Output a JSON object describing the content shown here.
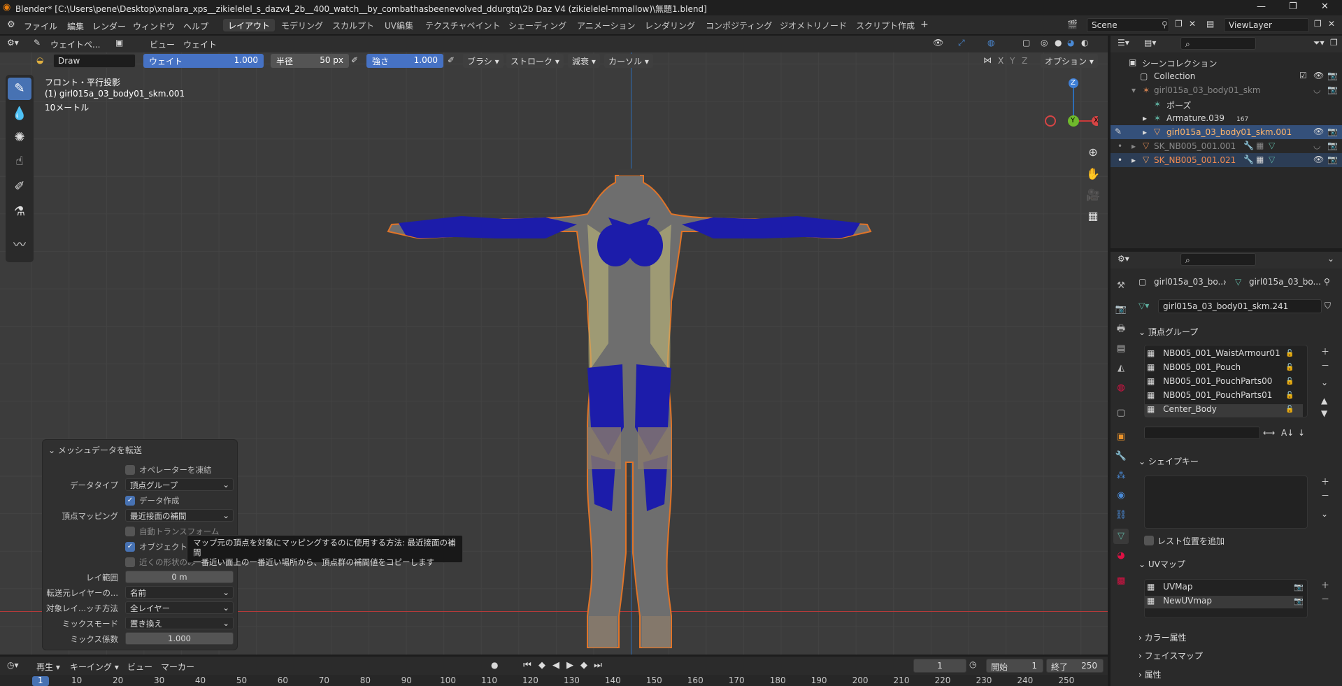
{
  "window_title": "Blender* [C:\\Users\\pene\\Desktop\\xnalara_xps__zikielelel_s_dazv4_2b__400_watch__by_combathasbeenevolved_ddurgtq\\2b Daz V4 (zikielelel-mmallow)\\無題1.blend]",
  "menus": [
    "ファイル",
    "編集",
    "レンダー",
    "ウィンドウ",
    "ヘルプ"
  ],
  "workspaces": [
    "レイアウト",
    "モデリング",
    "スカルプト",
    "UV編集",
    "テクスチャペイント",
    "シェーディング",
    "アニメーション",
    "レンダリング",
    "コンポジティング",
    "ジオメトリノード",
    "スクリプト作成"
  ],
  "add_workspace": "+",
  "scene": "Scene",
  "view_layer": "ViewLayer",
  "viewport_header": {
    "mode": "ウェイトペ...",
    "view": "ビュー",
    "weight": "ウェイト"
  },
  "tool_header": {
    "brush_name": "Draw",
    "weight_label": "ウェイト",
    "weight_value": "1.000",
    "radius_label": "半径",
    "radius_value": "50 px",
    "strength_label": "強さ",
    "strength_value": "1.000",
    "brush": "ブラシ",
    "stroke": "ストローク",
    "falloff": "減衰",
    "cursor": "カーソル",
    "axes": [
      "X",
      "Y",
      "Z"
    ],
    "options": "オプション"
  },
  "overlay_text": {
    "view_name": "フロント・平行投影",
    "object_name": "(1) girl015a_03_body01_skm.001",
    "scale": "10メートル"
  },
  "gizmo": {
    "z": "Z",
    "y": "Y",
    "x": "X"
  },
  "redo_panel": {
    "title": "メッシュデータを転送",
    "freeze_operator": "オペレーターを凍結",
    "data_type_label": "データタイプ",
    "data_type_value": "頂点グループ",
    "create_data": "データ作成",
    "vertex_mapping_label": "頂点マッピング",
    "vertex_mapping_value": "最近接面の補間",
    "auto_transform": "自動トランスフォーム",
    "object_transform": "オブジェクト",
    "only_neighbor": "近くの形状のみ",
    "ray_radius_label": "レイ範囲",
    "ray_radius_value": "0 m",
    "layers_select_src_label": "転送元レイヤーの...",
    "layers_select_src_value": "名前",
    "layers_select_dst_label": "対象レイ...ッチ方法",
    "layers_select_dst_value": "全レイヤー",
    "mix_mode_label": "ミックスモード",
    "mix_mode_value": "置き換え",
    "mix_factor_label": "ミックス係数",
    "mix_factor_value": "1.000"
  },
  "tooltip": {
    "line1": "マップ元の頂点を対象にマッピングするのに使用する方法: 最近接面の補間",
    "line2": "一番近い面上の一番近い場所から、頂点群の補間値をコピーします"
  },
  "outliner": {
    "scene_collection": "シーンコレクション",
    "rows": [
      {
        "label": "Collection",
        "indent": 1
      },
      {
        "label": "girl015a_03_body01_skm",
        "indent": 2,
        "dim": true
      },
      {
        "label": "ポーズ",
        "indent": 3
      },
      {
        "label": "Armature.039",
        "indent": 3,
        "badge": "167"
      },
      {
        "label": "girl015a_03_body01_skm.001",
        "indent": 3,
        "selected": true,
        "accent": true
      },
      {
        "label": "SK_NB005_001.001",
        "indent": 2,
        "dim": true
      },
      {
        "label": "SK_NB005_001.021",
        "indent": 2,
        "accent": true
      }
    ]
  },
  "properties": {
    "breadcrumb_a": "girl015a_03_bo...",
    "breadcrumb_b": "girl015a_03_bo...",
    "mesh_name": "girl015a_03_body01_skm.241",
    "vertex_groups_title": "頂点グループ",
    "vertex_groups": [
      "NB005_001_WaistArmour01",
      "NB005_001_Pouch",
      "NB005_001_PouchParts00",
      "NB005_001_PouchParts01",
      "Center_Body"
    ],
    "shape_keys_title": "シェイプキー",
    "rest_position": "レスト位置を追加",
    "uv_maps_title": "UVマップ",
    "uv_maps": [
      "UVMap",
      "NewUVmap"
    ],
    "color_attributes": "カラー属性",
    "face_maps": "フェイスマップ",
    "attributes": "属性"
  },
  "timeline": {
    "playback": "再生",
    "keying": "キーイング",
    "view": "ビュー",
    "marker": "マーカー",
    "current_frame": "1",
    "start_label": "開始",
    "start": "1",
    "end_label": "終了",
    "end": "250",
    "ticks": [
      "1",
      "10",
      "20",
      "30",
      "40",
      "50",
      "60",
      "70",
      "80",
      "90",
      "100",
      "110",
      "120",
      "130",
      "140",
      "150",
      "160",
      "170",
      "180",
      "190",
      "200",
      "210",
      "220",
      "230",
      "240",
      "250"
    ]
  }
}
